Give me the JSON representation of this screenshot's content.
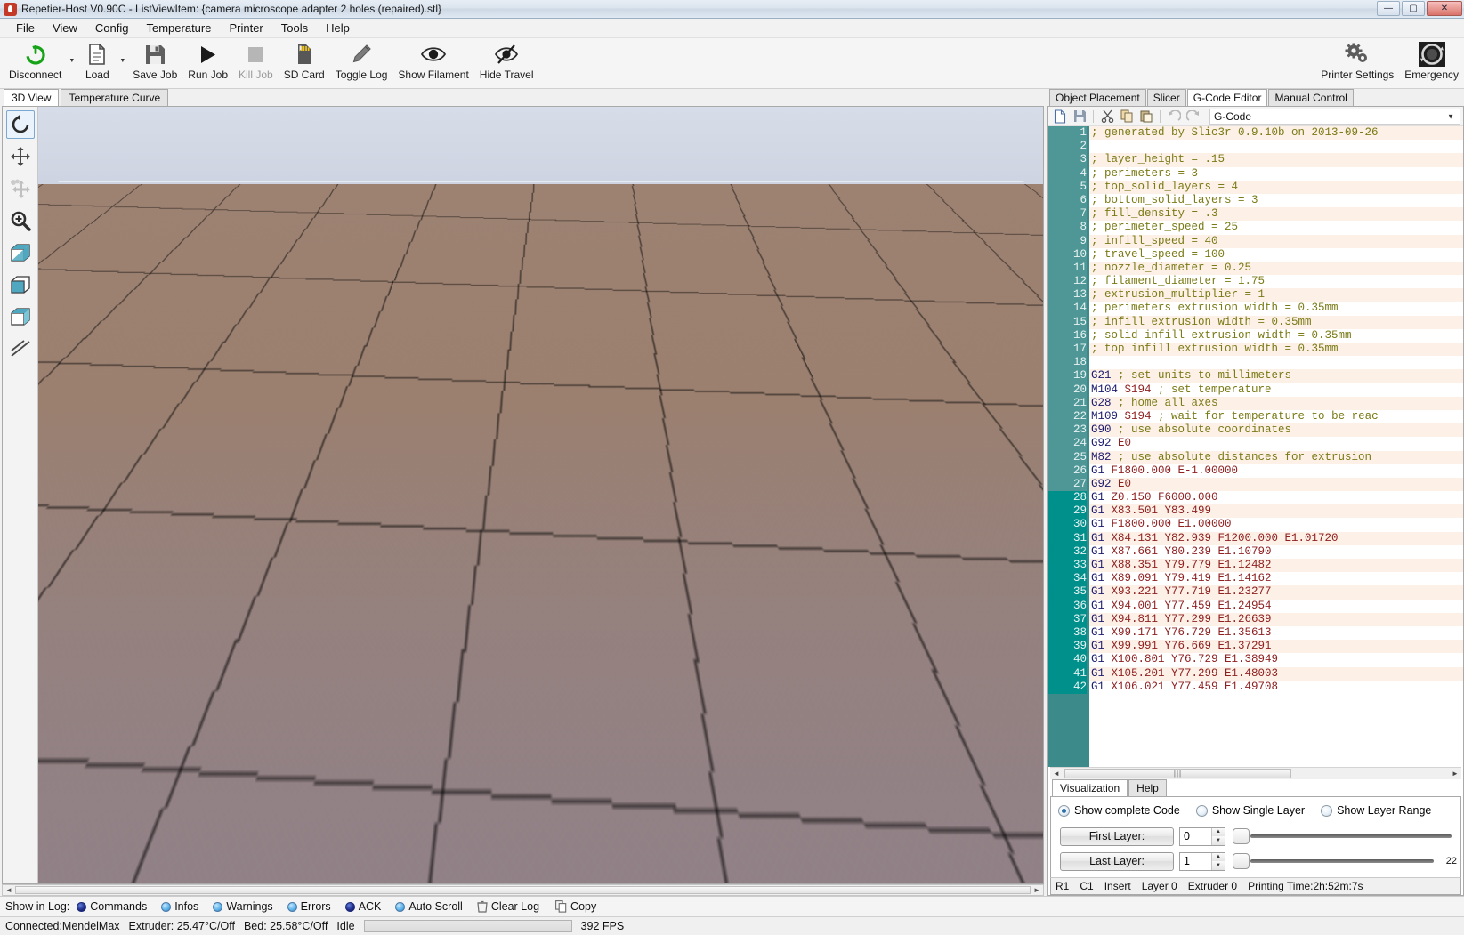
{
  "window": {
    "title": "Repetier-Host V0.90C - ListViewItem: {camera microscope adapter 2 holes (repaired).stl}",
    "minimize": "—",
    "maximize": "▢",
    "close": "✕"
  },
  "menu": [
    "File",
    "View",
    "Config",
    "Temperature",
    "Printer",
    "Tools",
    "Help"
  ],
  "toolbar": {
    "left": [
      {
        "label": "Disconnect",
        "icon": "power-icon",
        "dropdown": true,
        "disabled": false
      },
      {
        "label": "Load",
        "icon": "document-icon",
        "dropdown": true,
        "disabled": false
      },
      {
        "label": "Save Job",
        "icon": "floppy-disk-icon",
        "dropdown": false,
        "disabled": false
      },
      {
        "label": "Run Job",
        "icon": "play-icon",
        "dropdown": false,
        "disabled": false
      },
      {
        "label": "Kill Job",
        "icon": "stop-icon",
        "dropdown": false,
        "disabled": true
      },
      {
        "label": "SD Card",
        "icon": "sd-card-icon",
        "dropdown": false,
        "disabled": false
      },
      {
        "label": "Toggle Log",
        "icon": "pencil-icon",
        "dropdown": false,
        "disabled": false
      },
      {
        "label": "Show Filament",
        "icon": "eye-icon",
        "dropdown": false,
        "disabled": false
      },
      {
        "label": "Hide Travel",
        "icon": "eye-slash-icon",
        "dropdown": false,
        "disabled": false
      }
    ],
    "right": [
      {
        "label": "Printer Settings",
        "icon": "gears-icon"
      },
      {
        "label": "Emergency",
        "icon": "emergency-stop-icon"
      }
    ]
  },
  "view_tabs": [
    {
      "label": "3D View",
      "active": true
    },
    {
      "label": "Temperature Curve",
      "active": false
    }
  ],
  "view_tools": [
    {
      "name": "rotate-tool",
      "selected": true,
      "dimmed": false
    },
    {
      "name": "move-tool",
      "selected": false,
      "dimmed": false
    },
    {
      "name": "move-object-tool",
      "selected": false,
      "dimmed": true
    },
    {
      "name": "zoom-tool",
      "selected": false,
      "dimmed": false
    },
    {
      "name": "view-mode-split-tool",
      "selected": false,
      "dimmed": false
    },
    {
      "name": "view-mode-solid-tool",
      "selected": false,
      "dimmed": false
    },
    {
      "name": "view-mode-wireframe-tool",
      "selected": false,
      "dimmed": false
    },
    {
      "name": "view-mode-edges-tool",
      "selected": false,
      "dimmed": false
    }
  ],
  "right_tabs": [
    {
      "label": "Object Placement",
      "active": false
    },
    {
      "label": "Slicer",
      "active": false
    },
    {
      "label": "G-Code Editor",
      "active": true
    },
    {
      "label": "Manual Control",
      "active": false
    }
  ],
  "editor_toolbar": {
    "buttons": [
      {
        "name": "new-file-icon"
      },
      {
        "name": "save-file-icon"
      },
      {
        "name": "cut-icon"
      },
      {
        "name": "copy-icon"
      },
      {
        "name": "paste-icon"
      },
      {
        "name": "undo-icon"
      },
      {
        "name": "redo-icon"
      }
    ],
    "select_value": "G-Code"
  },
  "gcode": {
    "lines": [
      {
        "n": 1,
        "gutter": "warm",
        "alt": true,
        "parts": [
          {
            "t": "; generated by Slic3r 0.9.10b on 2013-09-26",
            "c": "cmt"
          }
        ]
      },
      {
        "n": 2,
        "gutter": "warm",
        "alt": false,
        "parts": []
      },
      {
        "n": 3,
        "gutter": "warm",
        "alt": true,
        "parts": [
          {
            "t": "; layer_height = .15",
            "c": "cmt"
          }
        ]
      },
      {
        "n": 4,
        "gutter": "warm",
        "alt": false,
        "parts": [
          {
            "t": "; perimeters = 3",
            "c": "cmt"
          }
        ]
      },
      {
        "n": 5,
        "gutter": "warm",
        "alt": true,
        "parts": [
          {
            "t": "; top_solid_layers = 4",
            "c": "cmt"
          }
        ]
      },
      {
        "n": 6,
        "gutter": "warm",
        "alt": false,
        "parts": [
          {
            "t": "; bottom_solid_layers = 3",
            "c": "cmt"
          }
        ]
      },
      {
        "n": 7,
        "gutter": "warm",
        "alt": true,
        "parts": [
          {
            "t": "; fill_density = .3",
            "c": "cmt"
          }
        ]
      },
      {
        "n": 8,
        "gutter": "warm",
        "alt": false,
        "parts": [
          {
            "t": "; perimeter_speed = 25",
            "c": "cmt"
          }
        ]
      },
      {
        "n": 9,
        "gutter": "warm",
        "alt": true,
        "parts": [
          {
            "t": "; infill_speed = 40",
            "c": "cmt"
          }
        ]
      },
      {
        "n": 10,
        "gutter": "warm",
        "alt": false,
        "parts": [
          {
            "t": "; travel_speed = 100",
            "c": "cmt"
          }
        ]
      },
      {
        "n": 11,
        "gutter": "warm",
        "alt": true,
        "parts": [
          {
            "t": "; nozzle_diameter = 0.25",
            "c": "cmt"
          }
        ]
      },
      {
        "n": 12,
        "gutter": "warm",
        "alt": false,
        "parts": [
          {
            "t": "; filament_diameter = 1.75",
            "c": "cmt"
          }
        ]
      },
      {
        "n": 13,
        "gutter": "warm",
        "alt": true,
        "parts": [
          {
            "t": "; extrusion_multiplier = 1",
            "c": "cmt"
          }
        ]
      },
      {
        "n": 14,
        "gutter": "warm",
        "alt": false,
        "parts": [
          {
            "t": "; perimeters extrusion width = 0.35mm",
            "c": "cmt"
          }
        ]
      },
      {
        "n": 15,
        "gutter": "warm",
        "alt": true,
        "parts": [
          {
            "t": "; infill extrusion width = 0.35mm",
            "c": "cmt"
          }
        ]
      },
      {
        "n": 16,
        "gutter": "warm",
        "alt": false,
        "parts": [
          {
            "t": "; solid infill extrusion width = 0.35mm",
            "c": "cmt"
          }
        ]
      },
      {
        "n": 17,
        "gutter": "warm",
        "alt": true,
        "parts": [
          {
            "t": "; top infill extrusion width = 0.35mm",
            "c": "cmt"
          }
        ]
      },
      {
        "n": 18,
        "gutter": "warm",
        "alt": false,
        "parts": []
      },
      {
        "n": 19,
        "gutter": "warm",
        "alt": true,
        "parts": [
          {
            "t": "G21 ",
            "c": "cmd"
          },
          {
            "t": "; set units to millimeters",
            "c": "cmt"
          }
        ]
      },
      {
        "n": 20,
        "gutter": "warm",
        "alt": false,
        "parts": [
          {
            "t": "M104 ",
            "c": "cmd"
          },
          {
            "t": "S194 ",
            "c": "prm"
          },
          {
            "t": "; set temperature",
            "c": "cmt"
          }
        ]
      },
      {
        "n": 21,
        "gutter": "warm",
        "alt": true,
        "parts": [
          {
            "t": "G28 ",
            "c": "cmd"
          },
          {
            "t": "; home all axes",
            "c": "cmt"
          }
        ]
      },
      {
        "n": 22,
        "gutter": "warm",
        "alt": false,
        "parts": [
          {
            "t": "M109 ",
            "c": "cmd"
          },
          {
            "t": "S194 ",
            "c": "prm"
          },
          {
            "t": "; wait for temperature to be reac",
            "c": "cmt"
          }
        ]
      },
      {
        "n": 23,
        "gutter": "warm",
        "alt": true,
        "parts": [
          {
            "t": "G90 ",
            "c": "cmd"
          },
          {
            "t": "; use absolute coordinates",
            "c": "cmt"
          }
        ]
      },
      {
        "n": 24,
        "gutter": "warm",
        "alt": false,
        "parts": [
          {
            "t": "G92 ",
            "c": "cmd"
          },
          {
            "t": "E0",
            "c": "prm"
          }
        ]
      },
      {
        "n": 25,
        "gutter": "warm",
        "alt": true,
        "parts": [
          {
            "t": "M82 ",
            "c": "cmd"
          },
          {
            "t": "; use absolute distances for extrusion",
            "c": "cmt"
          }
        ]
      },
      {
        "n": 26,
        "gutter": "warm",
        "alt": false,
        "parts": [
          {
            "t": "G1 ",
            "c": "cmd"
          },
          {
            "t": "F1800.000 E-1.00000",
            "c": "prm"
          }
        ]
      },
      {
        "n": 27,
        "gutter": "warm",
        "alt": true,
        "parts": [
          {
            "t": "G92 ",
            "c": "cmd"
          },
          {
            "t": "E0",
            "c": "prm"
          }
        ]
      },
      {
        "n": 28,
        "gutter": "hot",
        "alt": false,
        "parts": [
          {
            "t": "G1 ",
            "c": "cmd"
          },
          {
            "t": "Z0.150 F6000.000",
            "c": "prm"
          }
        ]
      },
      {
        "n": 29,
        "gutter": "hot",
        "alt": true,
        "parts": [
          {
            "t": "G1 ",
            "c": "cmd"
          },
          {
            "t": "X83.501 Y83.499",
            "c": "prm"
          }
        ]
      },
      {
        "n": 30,
        "gutter": "hot",
        "alt": false,
        "parts": [
          {
            "t": "G1 ",
            "c": "cmd"
          },
          {
            "t": "F1800.000 E1.00000",
            "c": "prm"
          }
        ]
      },
      {
        "n": 31,
        "gutter": "hot",
        "alt": true,
        "parts": [
          {
            "t": "G1 ",
            "c": "cmd"
          },
          {
            "t": "X84.131 Y82.939 F1200.000 E1.01720",
            "c": "prm"
          }
        ]
      },
      {
        "n": 32,
        "gutter": "hot",
        "alt": false,
        "parts": [
          {
            "t": "G1 ",
            "c": "cmd"
          },
          {
            "t": "X87.661 Y80.239 E1.10790",
            "c": "prm"
          }
        ]
      },
      {
        "n": 33,
        "gutter": "hot",
        "alt": true,
        "parts": [
          {
            "t": "G1 ",
            "c": "cmd"
          },
          {
            "t": "X88.351 Y79.779 E1.12482",
            "c": "prm"
          }
        ]
      },
      {
        "n": 34,
        "gutter": "hot",
        "alt": false,
        "parts": [
          {
            "t": "G1 ",
            "c": "cmd"
          },
          {
            "t": "X89.091 Y79.419 E1.14162",
            "c": "prm"
          }
        ]
      },
      {
        "n": 35,
        "gutter": "hot",
        "alt": true,
        "parts": [
          {
            "t": "G1 ",
            "c": "cmd"
          },
          {
            "t": "X93.221 Y77.719 E1.23277",
            "c": "prm"
          }
        ]
      },
      {
        "n": 36,
        "gutter": "hot",
        "alt": false,
        "parts": [
          {
            "t": "G1 ",
            "c": "cmd"
          },
          {
            "t": "X94.001 Y77.459 E1.24954",
            "c": "prm"
          }
        ]
      },
      {
        "n": 37,
        "gutter": "hot",
        "alt": true,
        "parts": [
          {
            "t": "G1 ",
            "c": "cmd"
          },
          {
            "t": "X94.811 Y77.299 E1.26639",
            "c": "prm"
          }
        ]
      },
      {
        "n": 38,
        "gutter": "hot",
        "alt": false,
        "parts": [
          {
            "t": "G1 ",
            "c": "cmd"
          },
          {
            "t": "X99.171 Y76.729 E1.35613",
            "c": "prm"
          }
        ]
      },
      {
        "n": 39,
        "gutter": "hot",
        "alt": true,
        "parts": [
          {
            "t": "G1 ",
            "c": "cmd"
          },
          {
            "t": "X99.991 Y76.669 E1.37291",
            "c": "prm"
          }
        ]
      },
      {
        "n": 40,
        "gutter": "hot",
        "alt": false,
        "parts": [
          {
            "t": "G1 ",
            "c": "cmd"
          },
          {
            "t": "X100.801 Y76.729 E1.38949",
            "c": "prm"
          }
        ]
      },
      {
        "n": 41,
        "gutter": "hot",
        "alt": true,
        "parts": [
          {
            "t": "G1 ",
            "c": "cmd"
          },
          {
            "t": "X105.201 Y77.299 E1.48003",
            "c": "prm"
          }
        ]
      },
      {
        "n": 42,
        "gutter": "hot",
        "alt": false,
        "parts": [
          {
            "t": "G1 ",
            "c": "cmd"
          },
          {
            "t": "X106.021 Y77.459 E1.49708",
            "c": "prm"
          }
        ]
      }
    ]
  },
  "viz": {
    "tabs": [
      {
        "label": "Visualization",
        "active": true
      },
      {
        "label": "Help",
        "active": false
      }
    ],
    "radios": [
      {
        "label": "Show complete Code",
        "selected": true
      },
      {
        "label": "Show Single Layer",
        "selected": false
      },
      {
        "label": "Show Layer Range",
        "selected": false
      }
    ],
    "first_layer": {
      "label": "First Layer:",
      "value": "0"
    },
    "last_layer": {
      "label": "Last Layer:",
      "value": "1",
      "tail": "22"
    }
  },
  "editor_status": {
    "row": "R1",
    "col": "C1",
    "mode": "Insert",
    "layer": "Layer 0",
    "extruder": "Extruder 0",
    "print_time": "Printing Time:2h:52m:7s"
  },
  "log_bar": {
    "label": "Show in Log:",
    "checks": [
      {
        "label": "Commands",
        "on": true
      },
      {
        "label": "Infos",
        "on": false
      },
      {
        "label": "Warnings",
        "on": false
      },
      {
        "label": "Errors",
        "on": false
      },
      {
        "label": "ACK",
        "on": true
      },
      {
        "label": "Auto Scroll",
        "on": false
      }
    ],
    "actions": [
      {
        "label": "Clear Log",
        "icon": "trash-icon"
      },
      {
        "label": "Copy",
        "icon": "copy-icon"
      }
    ]
  },
  "status_bar": {
    "connection": "Connected:MendelMax",
    "extruder": "Extruder: 25.47°C/Off",
    "bed": "Bed: 25.58°C/Off",
    "state": "Idle",
    "fps": "392 FPS"
  }
}
